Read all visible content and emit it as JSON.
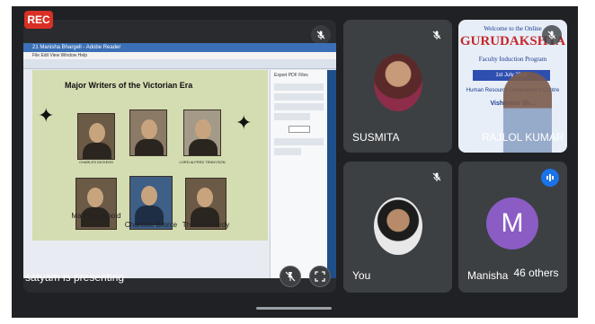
{
  "rec_label": "REC",
  "presenter": {
    "label": "satyam is presenting",
    "window_title": "21 Manisha Bhargell - Adobe Reader",
    "menu": "File   Edit   View   Window   Help",
    "slide": {
      "title": "Major Writers of the Victorian Era",
      "captions": [
        "Matthew Arnold",
        "Charlotte Bronte",
        "Thomas Hardy"
      ],
      "small_captions": [
        "CHARLES DICKENS",
        "Robert Browning",
        "LORD ALFRED TENNYSON"
      ]
    },
    "side_panel": {
      "header": "Export PDF Files"
    }
  },
  "participants": {
    "susmita": {
      "name": "SUSMITA"
    },
    "rajlol": {
      "name": "RAJLOL KUMAR",
      "banner_top": "Welcome to the Online",
      "banner_main": "GURUDAKSHTA",
      "banner_sub": "Faculty Induction Program",
      "banner_date": "1st July 2022",
      "banner_line": "Human Resource Development Centre",
      "banner_line2": "Vishankar Sh..."
    },
    "you": {
      "name": "You"
    },
    "manisha": {
      "name": "Manisha",
      "initial": "M",
      "others_label": "46 others"
    }
  },
  "colors": {
    "meet_bg": "#202124",
    "rec_red": "#d93025",
    "avatar_purple": "#8a5cc4",
    "speaking_blue": "#1a73e8"
  },
  "icons": [
    "mic-off-icon",
    "fullscreen-icon",
    "pin-off-icon",
    "speaking-icon"
  ]
}
